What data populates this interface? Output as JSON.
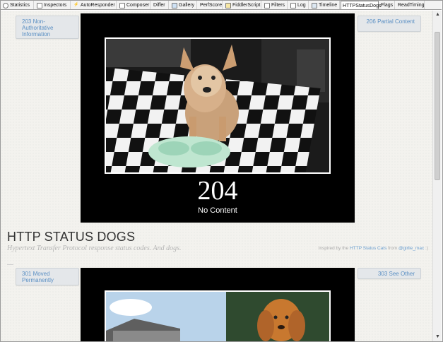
{
  "tabs": [
    {
      "label": "Statistics",
      "icon": "statistics-icon"
    },
    {
      "label": "Inspectors",
      "icon": "inspectors-icon"
    },
    {
      "label": "AutoResponder",
      "icon": "lightning-icon"
    },
    {
      "label": "Composer",
      "icon": "composer-icon"
    },
    {
      "label": "Differ",
      "icon": ""
    },
    {
      "label": "Gallery",
      "icon": "gallery-icon"
    },
    {
      "label": "PerfScore",
      "icon": ""
    },
    {
      "label": "FiddlerScript",
      "icon": "script-icon"
    },
    {
      "label": "Filters",
      "icon": "checkbox-icon"
    },
    {
      "label": "Log",
      "icon": "log-icon"
    },
    {
      "label": "Timeline",
      "icon": "timeline-icon"
    },
    {
      "label": "HTTPStatusDogs",
      "icon": ""
    },
    {
      "label": "Flags",
      "icon": ""
    },
    {
      "label": "ReadTiming",
      "icon": ""
    }
  ],
  "active_tab": "HTTPStatusDogs",
  "top_card": {
    "prev_label": "203 Non-Authoritative Information",
    "next_label": "206 Partial Content",
    "code": "204",
    "description": "No Content"
  },
  "header": {
    "title": "HTTP STATUS DOGS",
    "tagline": "Hypertext Transfer Protocol response status codes. And dogs.",
    "credits_prefix": "Inspired by the",
    "credits_link1": "HTTP Status Cats",
    "credits_mid": "from",
    "credits_link2": "@girlie_mac",
    "credits_suffix": ":)"
  },
  "bottom_card": {
    "prev_label": "301 Moved Permanently",
    "next_label": "303 See Other"
  },
  "colors": {
    "link_blue": "#5a8fc3",
    "page_bg": "#f3f2ee",
    "card_bg": "#000000"
  }
}
